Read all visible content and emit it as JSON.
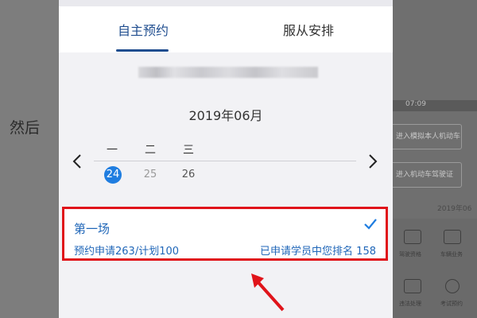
{
  "background": {
    "left_text": "然后",
    "right_time": "07:09",
    "right_button_1": "进入模拟本人机动车",
    "right_button_2": "进入机动车驾驶证",
    "right_date": "2019年06",
    "right_icon_labels": [
      "驾驶资格",
      "车辆业务",
      "违法处理",
      "考试预约"
    ]
  },
  "tabs": [
    {
      "label": "自主预约",
      "active": true
    },
    {
      "label": "服从安排",
      "active": false
    }
  ],
  "calendar": {
    "month": "2019年06月",
    "prev_icon": "chevron-left",
    "next_icon": "chevron-right",
    "weekdays": [
      "一",
      "二",
      "三"
    ],
    "days": [
      "24",
      "25",
      "26"
    ],
    "selected_day": "24"
  },
  "session": {
    "title": "第一场",
    "stats": "预约申请263/计划100",
    "rank_text": "已申请学员中您排名  158",
    "check_icon": "checkmark"
  },
  "colors": {
    "accent": "#1f7de0",
    "text_blue": "#1f66b8",
    "highlight_red": "#e0141a"
  }
}
